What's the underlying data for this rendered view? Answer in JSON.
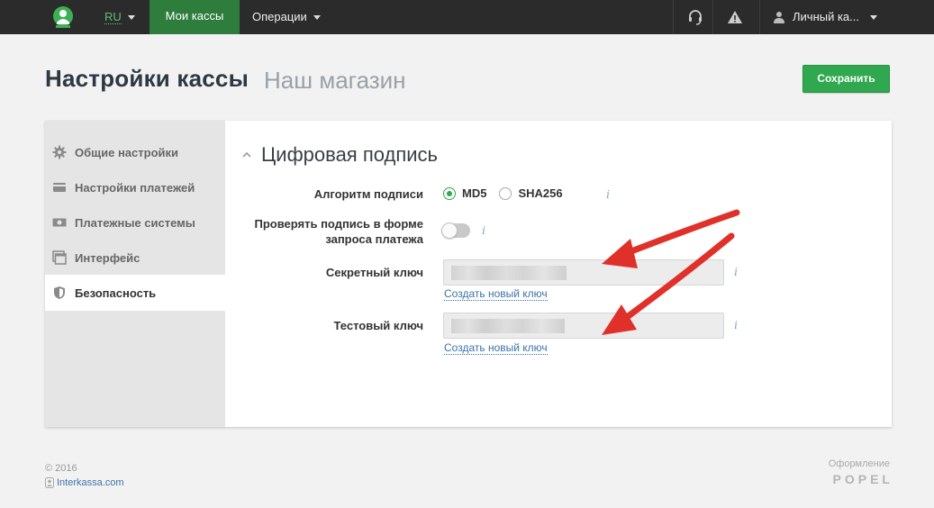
{
  "nav": {
    "lang": "RU",
    "my_cashboxes": "Мои кассы",
    "operations": "Операции",
    "account": "Личный ка..."
  },
  "header": {
    "title": "Настройки кассы",
    "subtitle": "Наш магазин",
    "save_label": "Сохранить"
  },
  "sidebar": {
    "items": [
      {
        "label": "Общие настройки",
        "icon": "gear-icon"
      },
      {
        "label": "Настройки платежей",
        "icon": "card-icon"
      },
      {
        "label": "Платежные системы",
        "icon": "money-icon"
      },
      {
        "label": "Интерфейс",
        "icon": "window-icon"
      },
      {
        "label": "Безопасность",
        "icon": "shield-icon",
        "active": true
      }
    ]
  },
  "section": {
    "title": "Цифровая подпись",
    "algorithm_label": "Алгоритм подписи",
    "algorithm_options": [
      "MD5",
      "SHA256"
    ],
    "algorithm_selected": "MD5",
    "verify_label_line1": "Проверять подпись в форме",
    "verify_label_line2": "запроса платежа",
    "verify_enabled": false,
    "secret_key_label": "Секретный ключ",
    "test_key_label": "Тестовый ключ",
    "generate_key_link": "Создать новый ключ"
  },
  "footer": {
    "copyright": "© 2016",
    "site_link": "Interkassa.com",
    "design_label": "Оформление",
    "design_brand": "POPEL"
  },
  "colors": {
    "topbar": "#2b2b2b",
    "nav_active": "#2f7d3c",
    "accent_green": "#2fa84f",
    "link_blue": "#3d73a8",
    "annotation_arrow": "#e0302a"
  }
}
